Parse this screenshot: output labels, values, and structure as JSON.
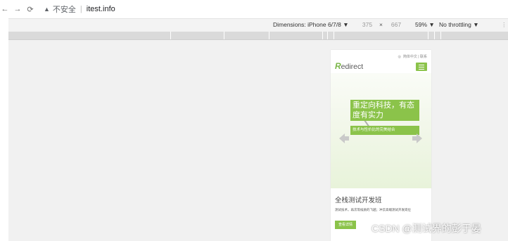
{
  "browser": {
    "back_icon": "arrow-left",
    "forward_icon": "arrow-right",
    "reload_icon": "reload",
    "security_icon": "warning-triangle",
    "security_label": "不安全",
    "url": "itest.info"
  },
  "device_toolbar": {
    "dimensions_label": "Dimensions: iPhone 6/7/8 ▼",
    "width_value": "375",
    "times": "×",
    "height_value": "667",
    "zoom": "59% ▼",
    "throttle": "No throttling ▼",
    "more": "⋮"
  },
  "site": {
    "top_nav": "简体中文 | 联系",
    "logo_first": "R",
    "logo_rest": "edirect",
    "menu_icon": "hamburger",
    "hero_title": "重定向科技，有态度有实力",
    "hero_subtitle": "技术与性价比的完美结合",
    "prev_icon": "arrow-left",
    "next_icon": "arrow-right",
    "section_title": "全栈测试开发班",
    "section_desc": "测试技术，再次等候质的飞越；冲云高端测试开发岗位",
    "detail_button": "查看详情",
    "accent_color": "#8bc34a"
  },
  "watermark": "CSDN @测试界的彭于晏"
}
